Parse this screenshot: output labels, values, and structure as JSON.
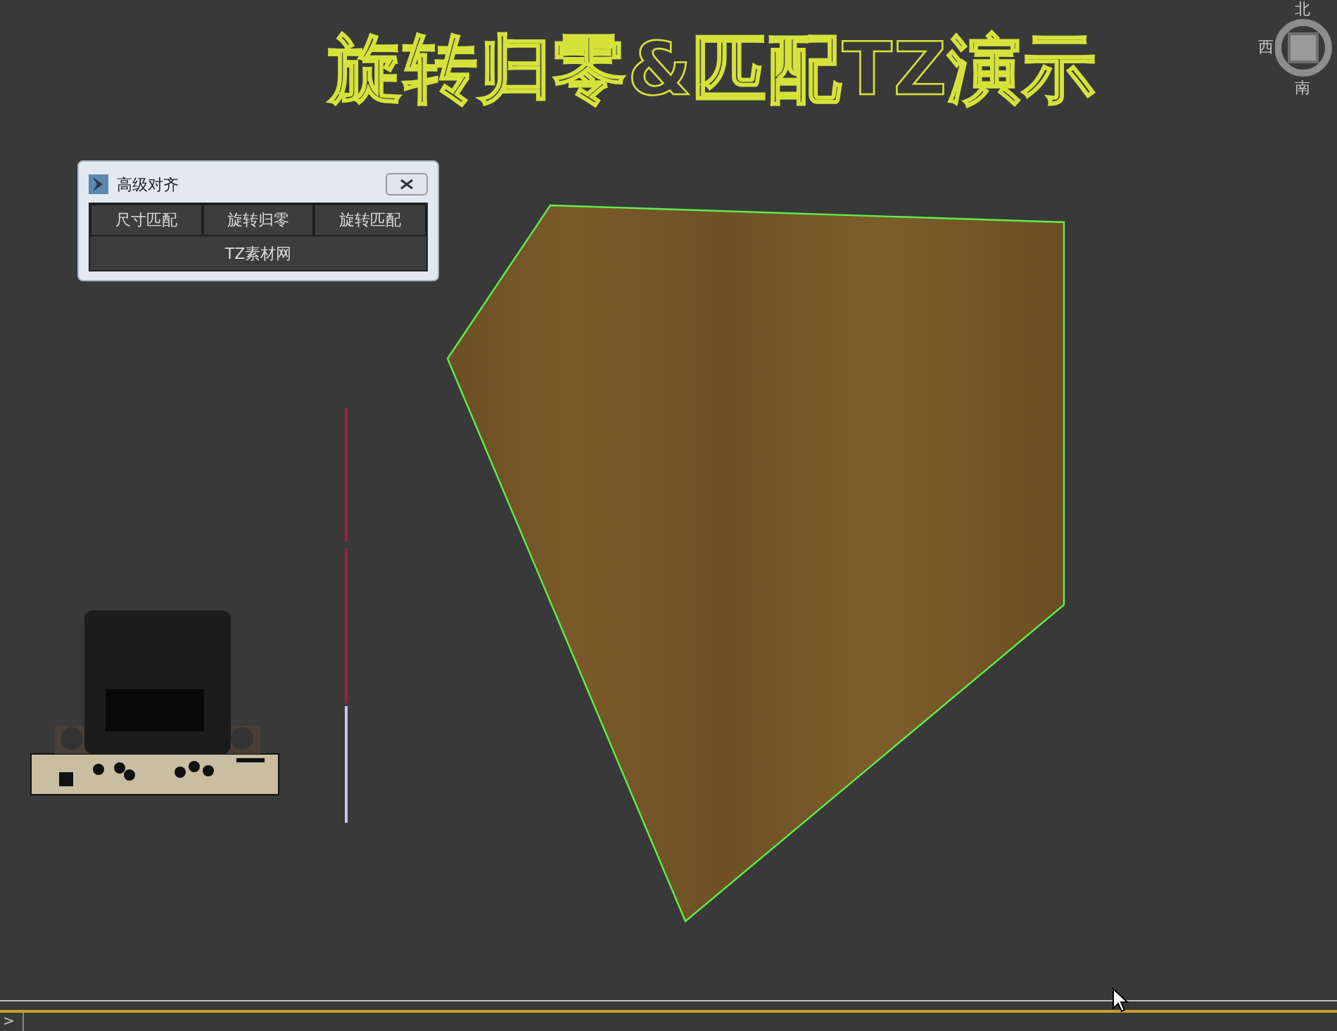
{
  "viewport": {
    "title": "旋转归零&匹配TZ演示"
  },
  "dialog": {
    "title": "高级对齐",
    "buttons": [
      "尺寸匹配",
      "旋转归零",
      "旋转匹配"
    ],
    "footer_button": "TZ素材网"
  },
  "viewcube": {
    "labels": [
      {
        "kind": "north",
        "text": "北"
      },
      {
        "kind": "west",
        "text": "西"
      },
      {
        "kind": "south",
        "text": "南"
      }
    ]
  },
  "command_line": {
    "prompt": ">"
  }
}
